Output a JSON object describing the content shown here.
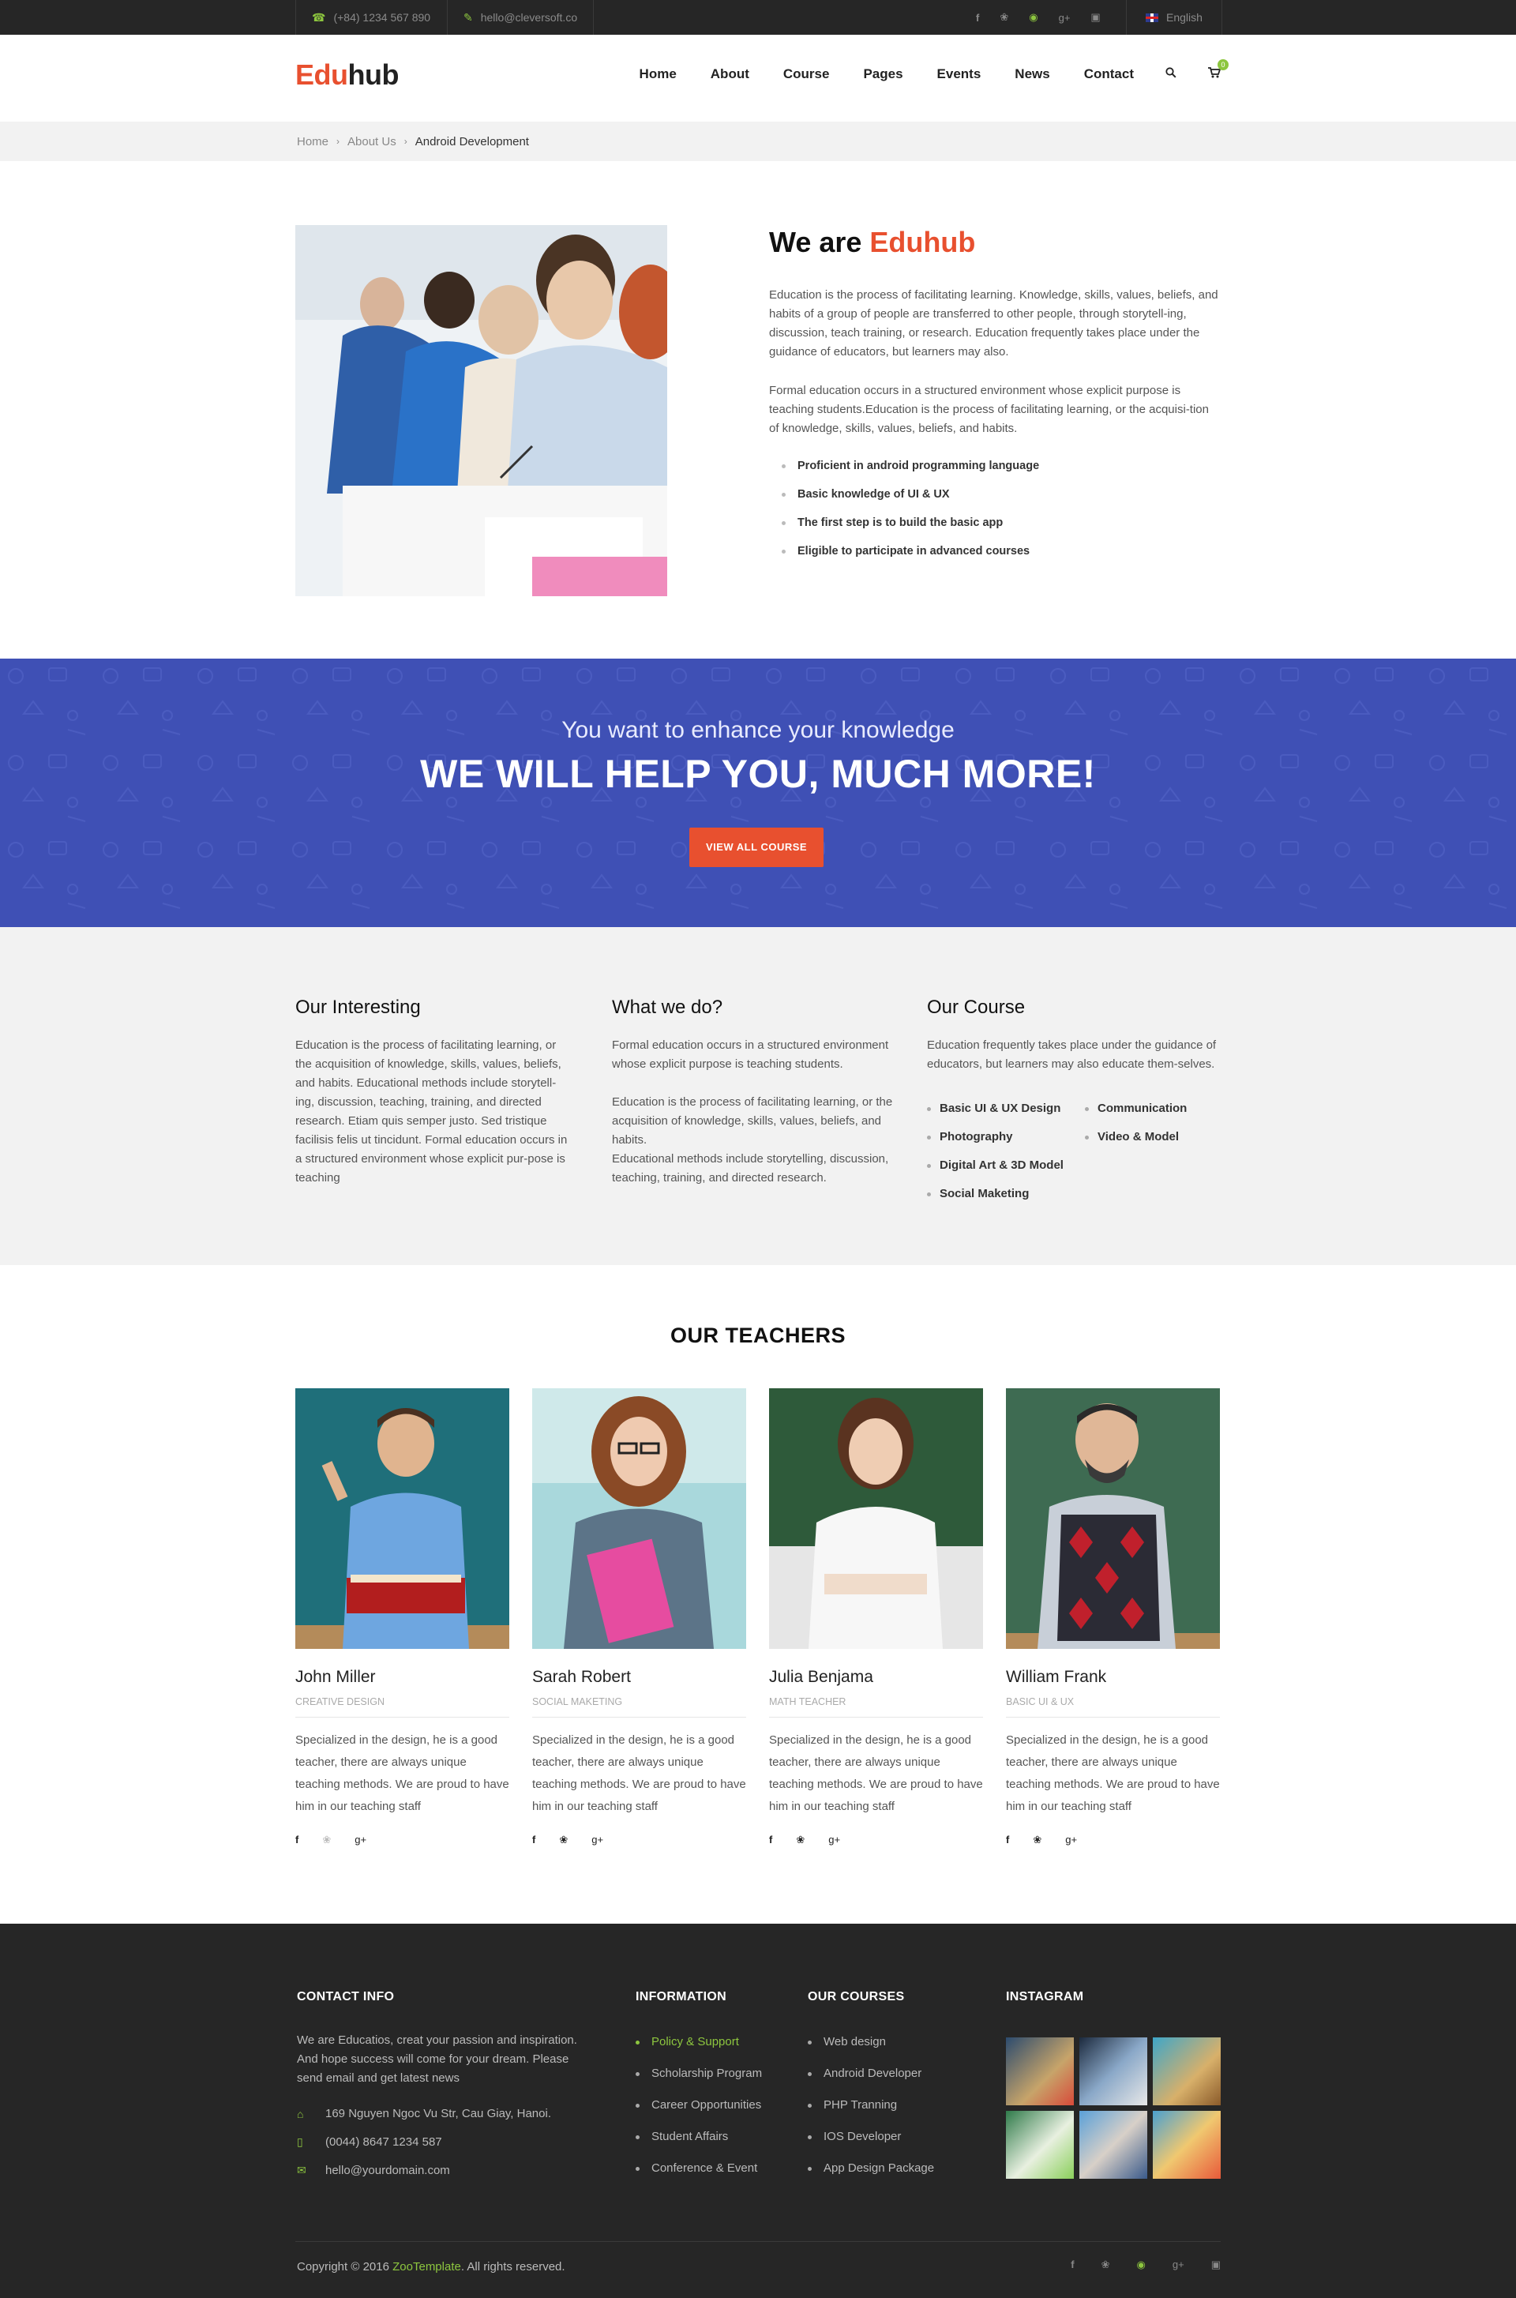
{
  "topbar": {
    "phone": "(+84) 1234 567 890",
    "email": "hello@cleversoft.co",
    "social": [
      "f",
      "t",
      "p",
      "g+",
      "ig"
    ],
    "language": "English"
  },
  "header": {
    "logo_a": "Edu",
    "logo_b": "hub",
    "nav": [
      "Home",
      "About",
      "Course",
      "Pages",
      "Events",
      "News",
      "Contact"
    ],
    "cart_count": "0"
  },
  "breadcrumb": {
    "items": [
      "Home",
      "About Us"
    ],
    "current": "Android Development"
  },
  "about": {
    "title_a": "We are ",
    "title_b": "Eduhub",
    "p1": "Education is the process of facilitating learning. Knowledge, skills, values, beliefs, and habits of a group of people are transferred to other people, through storytell-ing, discussion, teach training, or research. Education frequently takes place under the guidance of educators, but learners may also.",
    "p2": "Formal education occurs in a structured environment whose explicit purpose is teaching students.Education is the process of facilitating learning, or the acquisi-tion of knowledge, skills, values, beliefs, and habits.",
    "list": [
      "Proficient in android programming language",
      "Basic knowledge of UI & UX",
      "The first step is to build the basic app",
      "Eligible to participate in advanced courses"
    ]
  },
  "banner": {
    "subtitle": "You want to enhance your knowledge",
    "title": "WE WILL HELP YOU, MUCH MORE!",
    "button": "VIEW ALL COURSE"
  },
  "info": {
    "col1": {
      "title": "Our Interesting",
      "text": "Education is the process of facilitating learning, or the acquisition of knowledge, skills, values, beliefs, and habits. Educational methods include storytell-ing, discussion, teaching, training, and directed research. Etiam quis semper justo. Sed tristique facilisis felis ut tincidunt. Formal education occurs in a structured environment whose explicit pur-pose is teaching"
    },
    "col2": {
      "title": "What we do?",
      "p1": "Formal education occurs in a structured environment whose explicit purpose is teaching students.",
      "p2": "Education is the process of facilitating learning, or the acquisition of knowledge, skills, values, beliefs, and habits.",
      "p3": "Educational methods include storytelling, discussion, teaching, training, and directed research."
    },
    "col3": {
      "title": "Our Course",
      "text": "Education frequently takes place under the guidance of educators, but learners may also educate them-selves.",
      "left": [
        "Basic UI & UX Design",
        "Photography",
        "Digital Art & 3D Model",
        "Social Maketing"
      ],
      "right": [
        "Communication",
        "Video & Model"
      ]
    }
  },
  "teachers": {
    "title": "OUR TEACHERS",
    "items": [
      {
        "name": "John Miller",
        "role": "CREATIVE DESIGN",
        "desc": "Specialized in the design, he is a good teacher, there are always unique teaching methods. We are proud to have him in our teaching staff"
      },
      {
        "name": "Sarah Robert",
        "role": "SOCIAL MAKETING",
        "desc": "Specialized in the design, he is a good teacher, there are always unique teaching methods. We are proud to have him in our teaching staff"
      },
      {
        "name": "Julia Benjama",
        "role": "MATH TEACHER",
        "desc": "Specialized in the design, he is a good teacher, there are always unique teaching methods. We are proud to have him in our teaching staff"
      },
      {
        "name": "William Frank",
        "role": "BASIC UI & UX",
        "desc": "Specialized in the design, he is a good teacher, there are always unique teaching methods. We are proud to have him in our teaching staff"
      }
    ]
  },
  "footer": {
    "contact_title": "CONTACT INFO",
    "contact_text": "We are Educatios, creat your passion and inspiration. And hope success will come for your dream. Please send email and get latest news",
    "address": "169 Nguyen Ngoc Vu Str, Cau Giay, Hanoi.",
    "phone": "(0044) 8647 1234 587",
    "email": "hello@yourdomain.com",
    "info_title": "INFORMATION",
    "info_items": [
      "Policy & Support",
      "Scholarship Program",
      "Career Opportunities",
      "Student Affairs",
      "Conference & Event"
    ],
    "courses_title": "OUR COURSES",
    "course_items": [
      "Web design",
      "Android Developer",
      "PHP Tranning",
      "IOS Developer",
      "App Design Package"
    ],
    "instagram_title": "INSTAGRAM",
    "copyright_a": "Copyright © 2016 ",
    "copyright_link": "ZooTemplate",
    "copyright_b": ". All rights reserved."
  }
}
